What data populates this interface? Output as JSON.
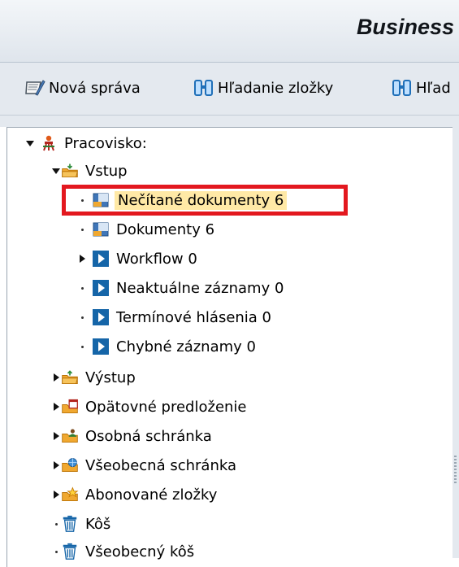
{
  "window": {
    "title": "Business"
  },
  "toolbar": {
    "new_message": "Nová správa",
    "search_folder": "Hľadanie zložky",
    "search_truncated": "Hľad"
  },
  "tree": {
    "root": "Pracovisko:",
    "inbox": "Vstup",
    "inbox_items": [
      "Nečítané dokumenty 6",
      "Dokumenty 6",
      "Workflow 0",
      "Neaktuálne záznamy 0",
      "Termínové hlásenia 0",
      "Chybné záznamy 0"
    ],
    "folders": [
      "Výstup",
      "Opätovné predloženie",
      "Osobná schránka",
      "Všeobecná schránka",
      "Abonované zložky",
      "Kôš",
      "Všeobecný kôš"
    ]
  },
  "colors": {
    "selection": "#ffe9a6",
    "highlight_border": "#e3181f",
    "folder_orange": "#f0a830",
    "blue_icon": "#1565a8"
  }
}
